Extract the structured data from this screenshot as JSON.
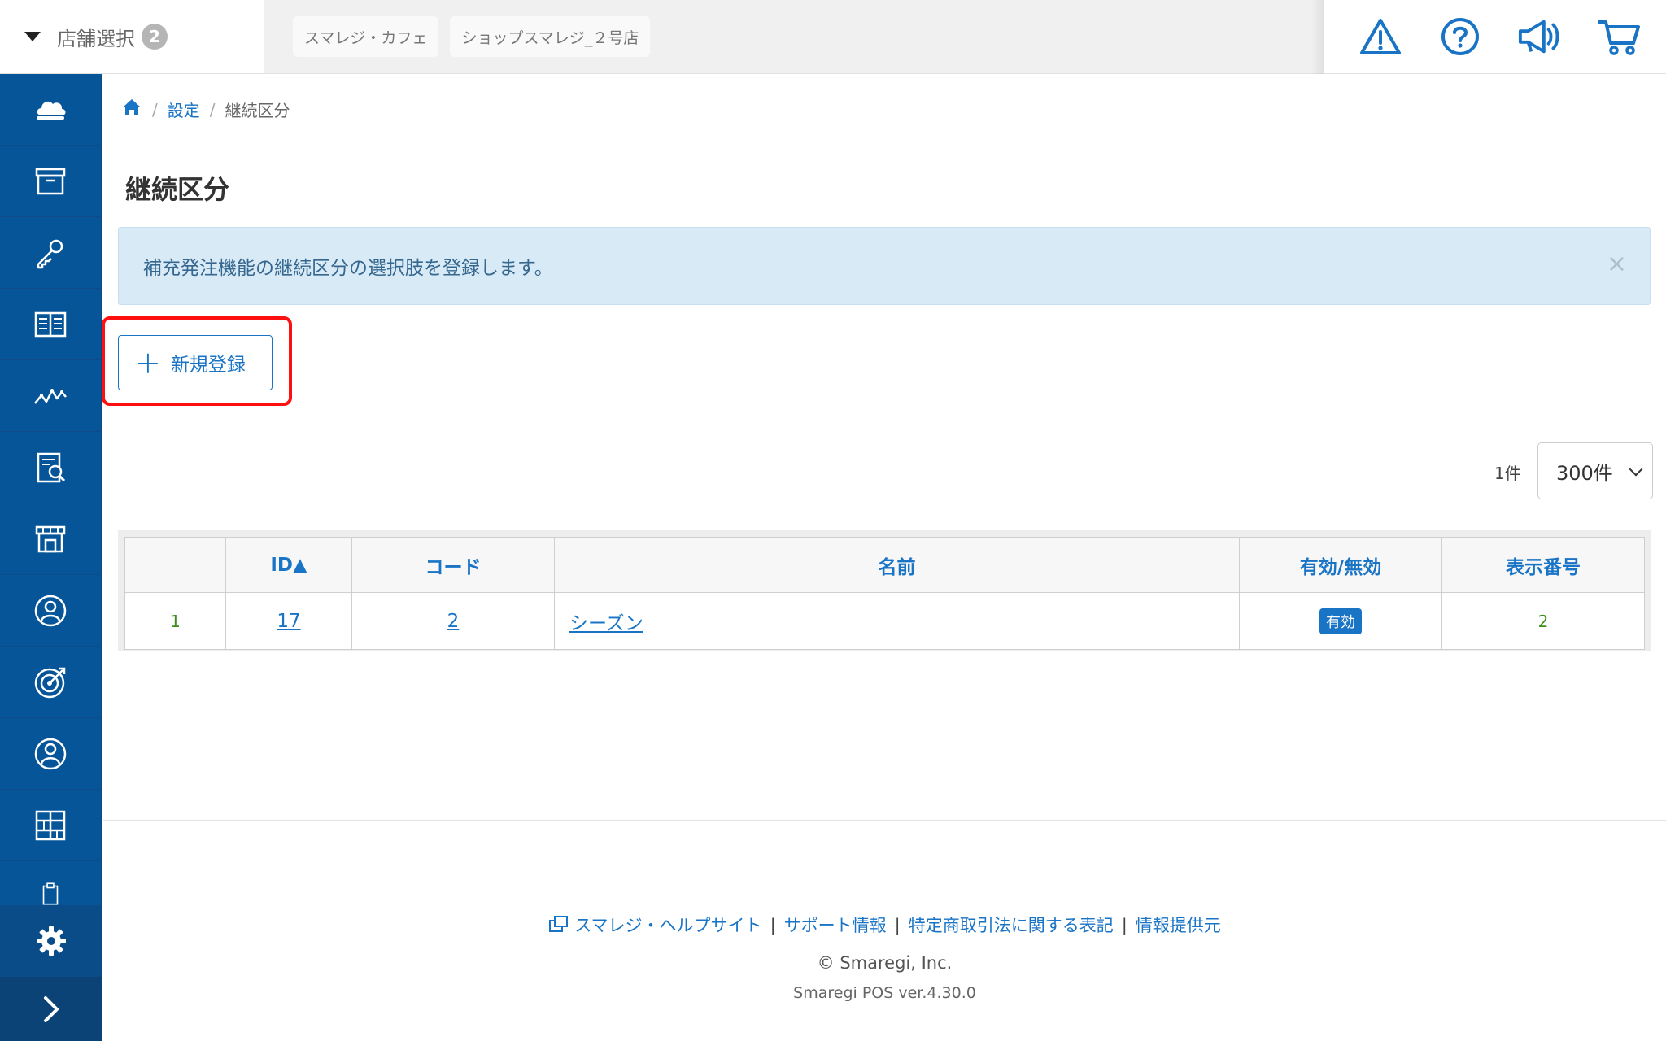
{
  "header": {
    "store_select_label": "店舗選択",
    "store_count": "2",
    "stores": [
      "スマレジ・カフェ",
      "ショップスマレジ_２号店"
    ]
  },
  "sidebar": {
    "icons": [
      "cloud-icon",
      "archive-box-icon",
      "key-icon",
      "book-icon",
      "chart-line-icon",
      "report-search-icon",
      "store-icon",
      "customer-icon",
      "target-icon",
      "user-icon",
      "grid-icon",
      "clipboard-icon",
      "gear-icon",
      "chevron-right-icon"
    ]
  },
  "breadcrumb": {
    "settings": "設定",
    "current": "継続区分"
  },
  "page": {
    "title": "継続区分",
    "info_message": "補充発注機能の継続区分の選択肢を登録します。",
    "close": "×",
    "new_button": "新規登録",
    "plus": "+"
  },
  "list": {
    "count": "1件",
    "per_page": "300件",
    "columns": [
      "",
      "ID▲",
      "コード",
      "名前",
      "有効/無効",
      "表示番号"
    ],
    "rows": [
      {
        "no": "1",
        "id": "17",
        "code": "2",
        "name": "シーズン",
        "status": "有効",
        "display_no": "2"
      }
    ]
  },
  "footer": {
    "help": "スマレジ・ヘルプサイト",
    "support": "サポート情報",
    "law": "特定商取引法に関する表記",
    "provider": "情報提供元",
    "copyright": "© Smaregi, Inc.",
    "version": "Smaregi POS ver.4.30.0"
  },
  "colors": {
    "sidebar": "#065598",
    "accent": "#1a74c6",
    "highlight": "#ff1010",
    "info_bg": "#d8eaf6"
  }
}
